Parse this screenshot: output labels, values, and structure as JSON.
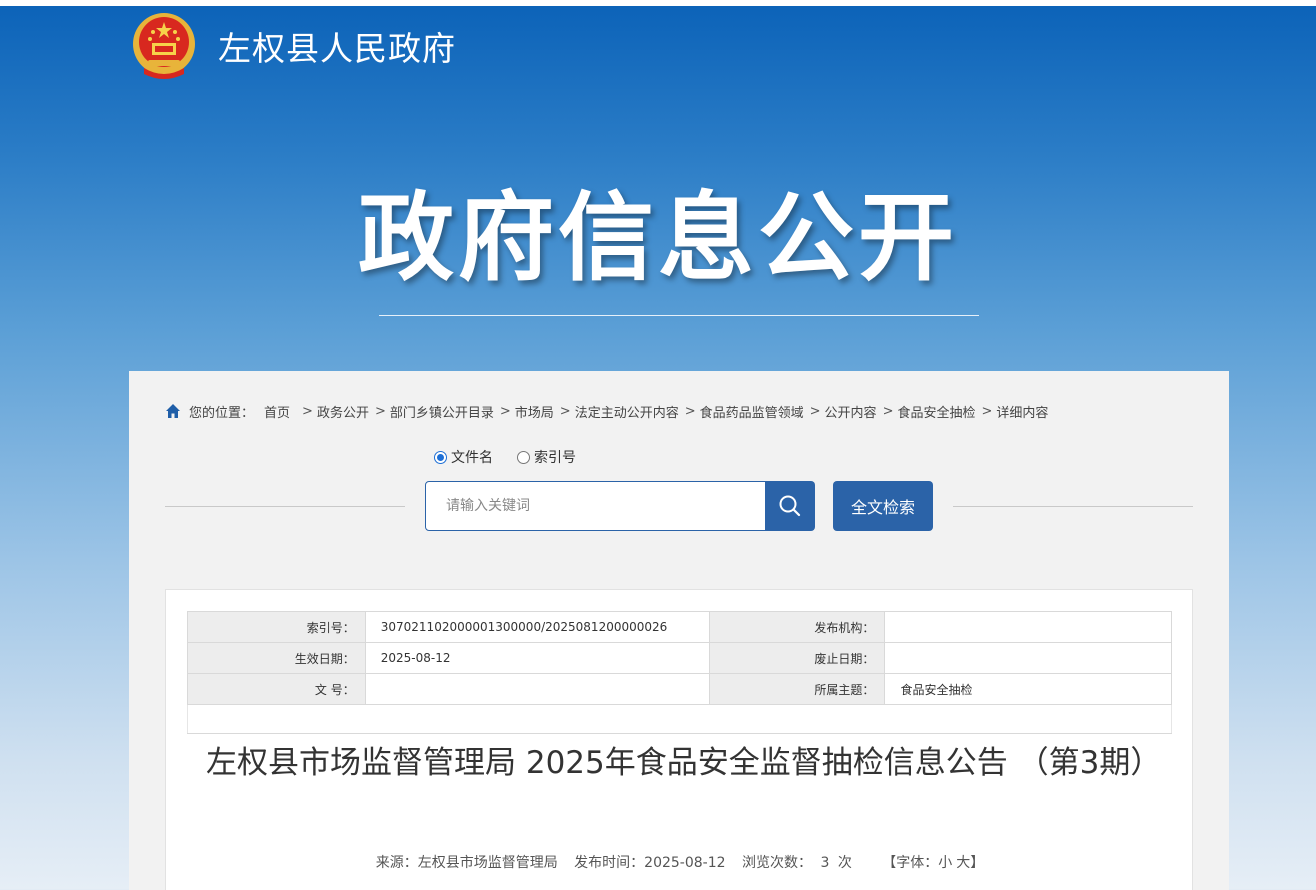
{
  "site": {
    "title": "左权县人民政府"
  },
  "banner": {
    "title": "政府信息公开"
  },
  "breadcrumb": {
    "prefix": "您的位置：",
    "items": [
      "首页",
      "政务公开",
      "部门乡镇公开目录",
      "市场局",
      "法定主动公开内容",
      "食品药品监管领域",
      "公开内容",
      "食品安全抽检",
      "详细内容"
    ],
    "separator": ">"
  },
  "search": {
    "options": [
      "文件名",
      "索引号"
    ],
    "selected": "文件名",
    "placeholder": "请输入关键词",
    "value": "",
    "fulltext_label": "全文检索"
  },
  "meta": {
    "index_label": "索引号：",
    "index_value": "307021102000001300000/2025081200000026",
    "publisher_label": "发布机构：",
    "publisher_value": "",
    "effective_label": "生效日期：",
    "effective_value": "2025-08-12",
    "expire_label": "废止日期：",
    "expire_value": "",
    "docno_label": "文 号：",
    "docno_value": "",
    "topic_label": "所属主题：",
    "topic_value": "食品安全抽检"
  },
  "document": {
    "title": "左权县市场监督管理局 2025年食品安全监督抽检信息公告 （第3期）",
    "source": "来源：左权县市场监督管理局",
    "publish_time": "发布时间：2025-08-12",
    "views_label": "浏览次数：",
    "views": "3",
    "views_unit": "次",
    "font_label": "【字体：",
    "font_small": "小",
    "font_large": "大",
    "font_close": "】"
  },
  "colors": {
    "primary": "#2b63a8",
    "banner_top": "#0b62b8"
  },
  "icons": {
    "home": "home-icon",
    "search": "search-icon",
    "emblem": "national-emblem-icon"
  }
}
